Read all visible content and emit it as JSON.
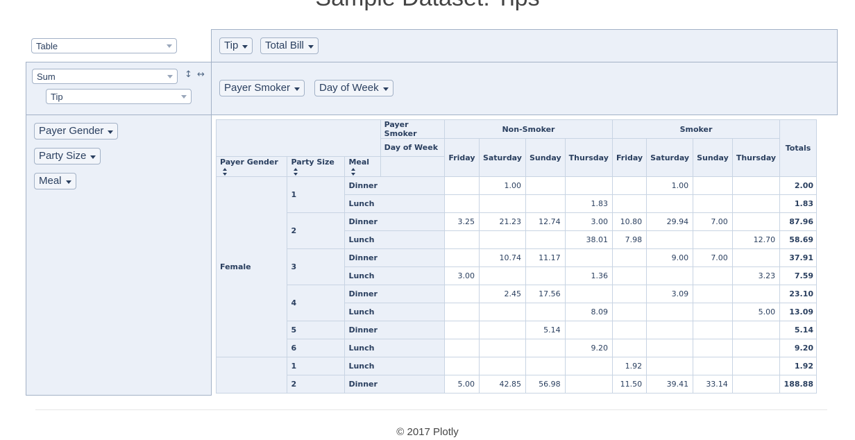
{
  "page": {
    "title": "Sample Dataset: Tips",
    "footer": "© 2017 Plotly"
  },
  "controls": {
    "renderer": "Table",
    "aggregator": "Sum",
    "value_field": "Tip",
    "row_order_icon": "↕",
    "col_order_icon": "↔"
  },
  "unused_fields": [
    "Tip",
    "Total Bill"
  ],
  "column_fields": [
    "Payer Smoker",
    "Day of Week"
  ],
  "row_fields": [
    "Payer Gender",
    "Party Size",
    "Meal"
  ],
  "table": {
    "col_attr_labels": [
      "Payer Smoker",
      "Day of Week"
    ],
    "row_attr_labels": [
      "Payer Gender",
      "Party Size",
      "Meal"
    ],
    "smoker_groups": [
      "Non-Smoker",
      "Smoker"
    ],
    "days": [
      "Friday",
      "Saturday",
      "Sunday",
      "Thursday",
      "Friday",
      "Saturday",
      "Sunday",
      "Thursday"
    ],
    "totals_label": "Totals",
    "rows": [
      {
        "gender": "Female",
        "size": "1",
        "meal": "Dinner",
        "vals": [
          "",
          "1.00",
          "",
          "",
          "",
          "1.00",
          "",
          ""
        ],
        "total": "2.00"
      },
      {
        "gender": "Female",
        "size": "1",
        "meal": "Lunch",
        "vals": [
          "",
          "",
          "",
          "1.83",
          "",
          "",
          "",
          ""
        ],
        "total": "1.83"
      },
      {
        "gender": "Female",
        "size": "2",
        "meal": "Dinner",
        "vals": [
          "3.25",
          "21.23",
          "12.74",
          "3.00",
          "10.80",
          "29.94",
          "7.00",
          ""
        ],
        "total": "87.96"
      },
      {
        "gender": "Female",
        "size": "2",
        "meal": "Lunch",
        "vals": [
          "",
          "",
          "",
          "38.01",
          "7.98",
          "",
          "",
          "12.70"
        ],
        "total": "58.69"
      },
      {
        "gender": "Female",
        "size": "3",
        "meal": "Dinner",
        "vals": [
          "",
          "10.74",
          "11.17",
          "",
          "",
          "9.00",
          "7.00",
          ""
        ],
        "total": "37.91"
      },
      {
        "gender": "Female",
        "size": "3",
        "meal": "Lunch",
        "vals": [
          "3.00",
          "",
          "",
          "1.36",
          "",
          "",
          "",
          "3.23"
        ],
        "total": "7.59"
      },
      {
        "gender": "Female",
        "size": "4",
        "meal": "Dinner",
        "vals": [
          "",
          "2.45",
          "17.56",
          "",
          "",
          "3.09",
          "",
          ""
        ],
        "total": "23.10"
      },
      {
        "gender": "Female",
        "size": "4",
        "meal": "Lunch",
        "vals": [
          "",
          "",
          "",
          "8.09",
          "",
          "",
          "",
          "5.00"
        ],
        "total": "13.09"
      },
      {
        "gender": "Female",
        "size": "5",
        "meal": "Dinner",
        "vals": [
          "",
          "",
          "5.14",
          "",
          "",
          "",
          "",
          ""
        ],
        "total": "5.14"
      },
      {
        "gender": "Female",
        "size": "6",
        "meal": "Lunch",
        "vals": [
          "",
          "",
          "",
          "9.20",
          "",
          "",
          "",
          ""
        ],
        "total": "9.20"
      },
      {
        "gender": "",
        "size": "1",
        "meal": "Lunch",
        "vals": [
          "",
          "",
          "",
          "",
          "1.92",
          "",
          "",
          ""
        ],
        "total": "1.92"
      },
      {
        "gender": "",
        "size": "2",
        "meal": "Dinner",
        "vals": [
          "5.00",
          "42.85",
          "56.98",
          "",
          "11.50",
          "39.41",
          "33.14",
          ""
        ],
        "total": "188.88"
      }
    ]
  }
}
